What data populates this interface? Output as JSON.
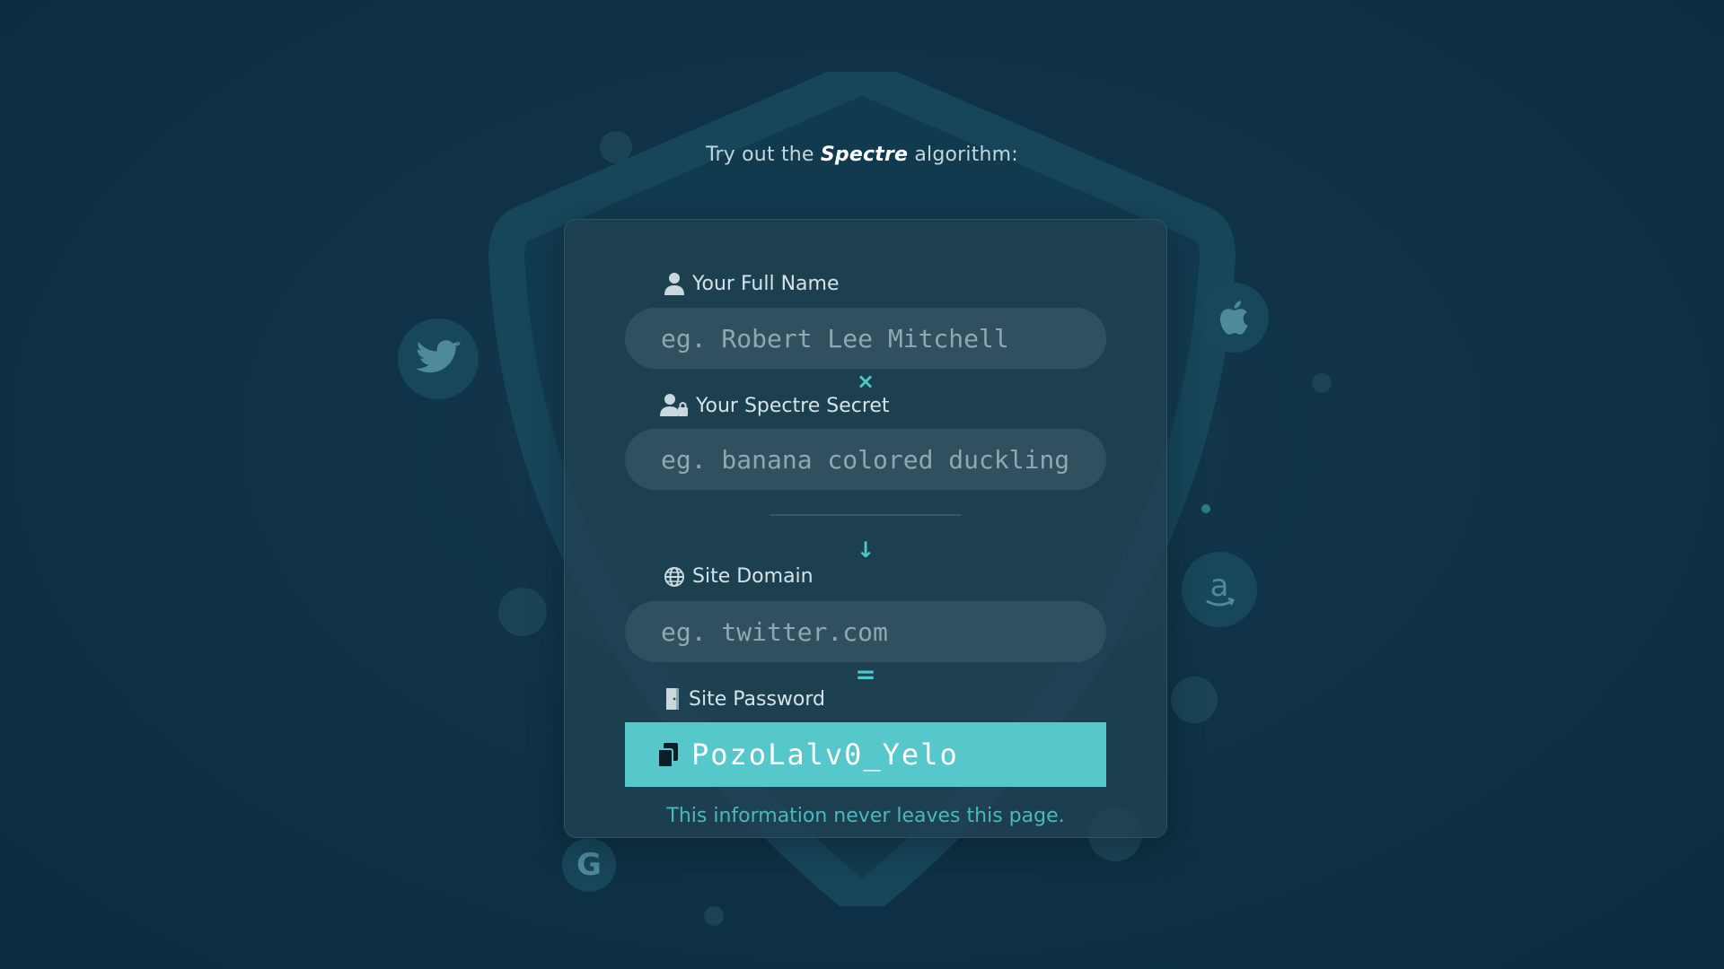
{
  "tagline": {
    "prefix": "Try out the",
    "brand": "Spectre",
    "suffix": "algorithm:"
  },
  "form": {
    "name": {
      "label": "Your Full Name",
      "placeholder": "eg. Robert Lee Mitchell",
      "icon": "user-icon"
    },
    "secret": {
      "label": "Your Spectre Secret",
      "placeholder": "eg. banana colored duckling",
      "icon": "user-lock-icon"
    },
    "site": {
      "label": "Site Domain",
      "placeholder": "eg. twitter.com",
      "icon": "globe-icon"
    },
    "password": {
      "label": "Site Password",
      "value": "PozoLalv0_Yelo",
      "icon": "door-icon",
      "copy_icon": "copy-icon"
    },
    "operators": {
      "times": "×",
      "arrow": "↓",
      "equals": "="
    },
    "note": "This information never leaves this page."
  },
  "brands": [
    "twitter-icon",
    "apple-icon",
    "amazon-icon",
    "google-icon"
  ],
  "colors": {
    "background": "#0f3246",
    "accent": "#56c8cb",
    "card": "#204252"
  }
}
